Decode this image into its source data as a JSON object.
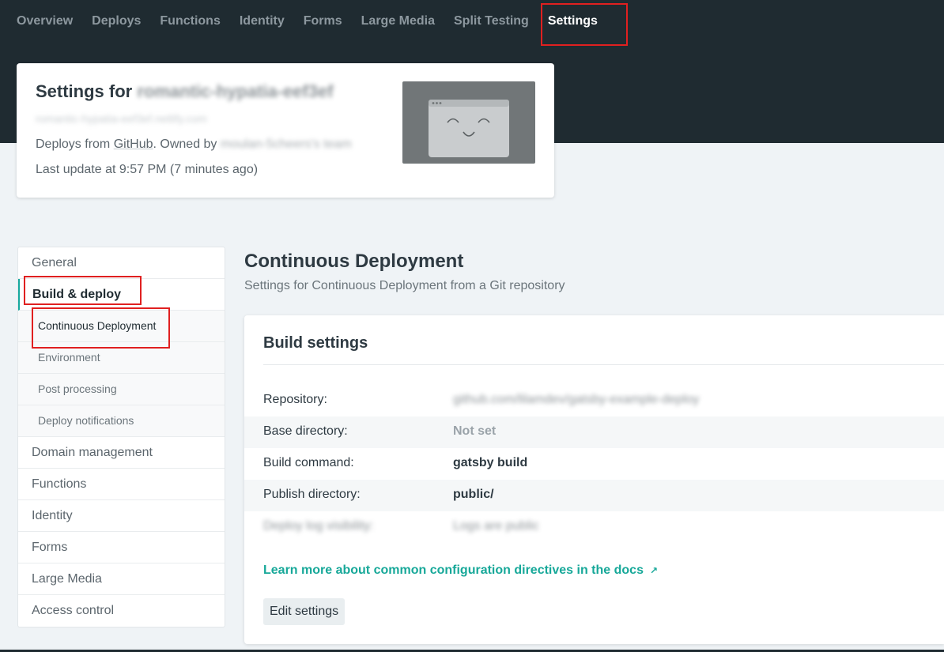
{
  "nav": {
    "items": [
      {
        "label": "Overview"
      },
      {
        "label": "Deploys"
      },
      {
        "label": "Functions"
      },
      {
        "label": "Identity"
      },
      {
        "label": "Forms"
      },
      {
        "label": "Large Media"
      },
      {
        "label": "Split Testing"
      },
      {
        "label": "Settings",
        "active": true
      }
    ]
  },
  "site": {
    "title_prefix": "Settings for",
    "name": "romantic-hypatia-eef3ef",
    "url": "romantic-hypatia-eef3ef.netlify.com",
    "deploys_prefix": "Deploys from",
    "provider": "GitHub",
    "owned_by": ". Owned by",
    "team": "moulan-5cheers's team",
    "last_update": "Last update at 9:57 PM (7 minutes ago)"
  },
  "sidebar": {
    "items": [
      {
        "label": "General"
      },
      {
        "label": "Build & deploy",
        "active": true
      },
      {
        "label": "Continuous Deployment",
        "sub": true,
        "active": true
      },
      {
        "label": "Environment",
        "sub": true
      },
      {
        "label": "Post processing",
        "sub": true
      },
      {
        "label": "Deploy notifications",
        "sub": true
      },
      {
        "label": "Domain management"
      },
      {
        "label": "Functions"
      },
      {
        "label": "Identity"
      },
      {
        "label": "Forms"
      },
      {
        "label": "Large Media"
      },
      {
        "label": "Access control"
      }
    ]
  },
  "main": {
    "title": "Continuous Deployment",
    "subtitle": "Settings for Continuous Deployment from a Git repository"
  },
  "build": {
    "title": "Build settings",
    "rows": [
      {
        "label": "Repository:",
        "value": "github.com/lilamdev/gatsby-example-deploy"
      },
      {
        "label": "Base directory:",
        "value": "Not set"
      },
      {
        "label": "Build command:",
        "value": "gatsby build"
      },
      {
        "label": "Publish directory:",
        "value": "public/"
      },
      {
        "label": "Deploy log visibility:",
        "value": "Logs are public"
      }
    ],
    "docs_link": "Learn more about common configuration directives in the docs",
    "docs_link_icon": "↗",
    "edit_button": "Edit settings"
  },
  "colors": {
    "header_bg": "#1f2b31",
    "accent": "#17a899",
    "highlight": "#e02020"
  }
}
